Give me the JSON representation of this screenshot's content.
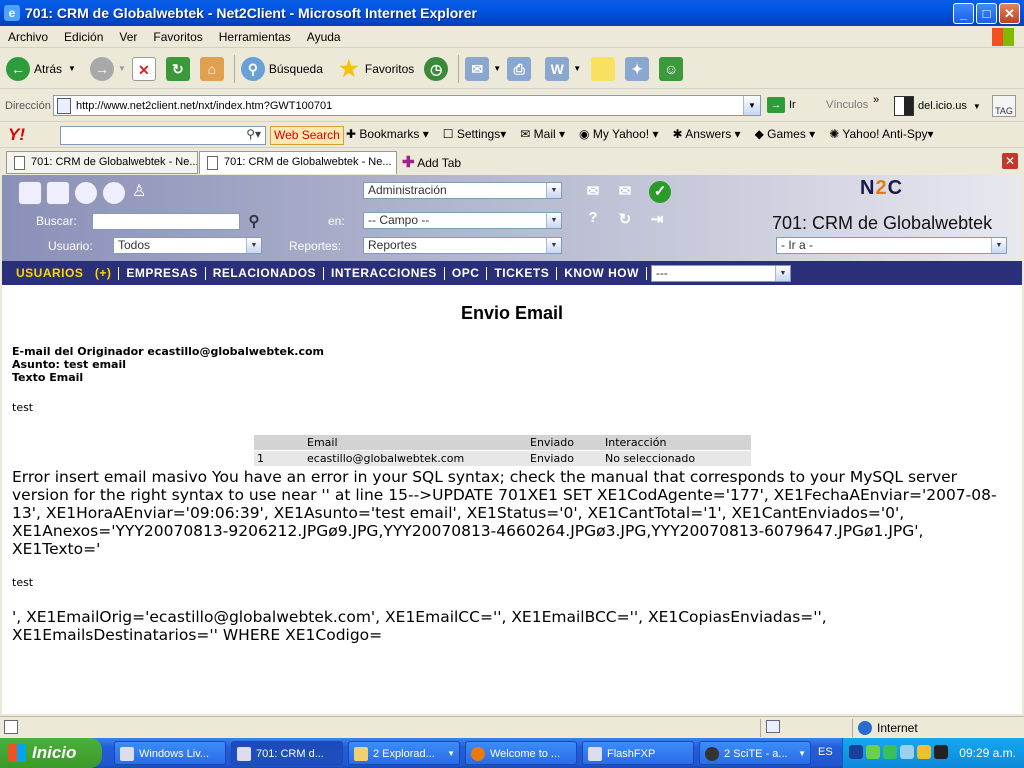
{
  "window": {
    "title": "701: CRM de Globalwebtek - Net2Client - Microsoft Internet Explorer",
    "min": "_",
    "max": "□",
    "close": "✕"
  },
  "menu": [
    "Archivo",
    "Edición",
    "Ver",
    "Favoritos",
    "Herramientas",
    "Ayuda"
  ],
  "toolbar": {
    "back": "Atrás",
    "search": "Búsqueda",
    "favorites": "Favoritos"
  },
  "address": {
    "label": "Dirección",
    "url": "http://www.net2client.net/nxt/index.htm?GWT100701",
    "go": "Ir",
    "links": "Vínculos",
    "delicious": "del.icio.us",
    "tag": "TAG"
  },
  "yahoo": {
    "logo": "Y!",
    "search_button": "Web Search",
    "items": [
      "Bookmarks",
      "Settings",
      "Mail",
      "My Yahoo!",
      "Answers",
      "Games",
      "Yahoo! Anti-Spy"
    ]
  },
  "tabs": {
    "tab1": "701: CRM de Globalwebtek - Ne...",
    "tab2": "701: CRM de Globalwebtek - Ne...",
    "add": "Add Tab"
  },
  "crm": {
    "admin_select": "Administración",
    "search_label": "Buscar:",
    "en_label": "en:",
    "campo_select": "-- Campo --",
    "user_label": "Usuario:",
    "user_select": "Todos",
    "reports_label": "Reportes:",
    "reports_select": "Reportes",
    "title": "701: CRM de Globalwebtek",
    "goto_select": "- Ir a -",
    "logo": "N2C"
  },
  "nav": {
    "items": [
      "USUARIOS   (+)",
      "EMPRESAS",
      "RELACIONADOS",
      "INTERACCIONES",
      "OPC",
      "TICKETS",
      "KNOW HOW"
    ],
    "select": "---"
  },
  "email": {
    "heading": "Envio Email",
    "originator": "E-mail del Originador ecastillo@globalwebtek.com",
    "subject": "Asunto: test email",
    "body_label": "Texto Email",
    "body": "test"
  },
  "table": {
    "headers": [
      "",
      "Email",
      "Enviado",
      "Interacción"
    ],
    "rows": [
      [
        "1",
        "ecastillo@globalwebtek.com",
        "Enviado",
        "No seleccionado"
      ]
    ]
  },
  "error": {
    "part1": "Error insert email masivo You have an error in your SQL syntax; check the manual that corresponds to your MySQL server version for the right syntax to use near '' at line 15-->UPDATE 701XE1 SET XE1CodAgente='177', XE1FechaAEnviar='2007-08-13', XE1HoraAEnviar='09:06:39', XE1Asunto='test email', XE1Status='0', XE1CantTotal='1', XE1CantEnviados='0', XE1Anexos='YYY20070813-9206212.JPGø9.JPG,YYY20070813-4660264.JPGø3.JPG,YYY20070813-6079647.JPGø1.JPG', XE1Texto='",
    "middle": "test",
    "part2": "', XE1EmailOrig='ecastillo@globalwebtek.com', XE1EmailCC='', XE1EmailBCC='', XE1CopiasEnviadas='', XE1EmailsDestinatarios='' WHERE XE1Codigo="
  },
  "status": {
    "zone": "Internet"
  },
  "taskbar": {
    "start": "Inicio",
    "tasks": [
      "Windows Liv...",
      "701: CRM d...",
      "2 Explorad...",
      "Welcome to ...",
      "FlashFXP",
      "2 SciTE - a..."
    ],
    "lang": "ES",
    "clock": "09:29 a.m."
  }
}
